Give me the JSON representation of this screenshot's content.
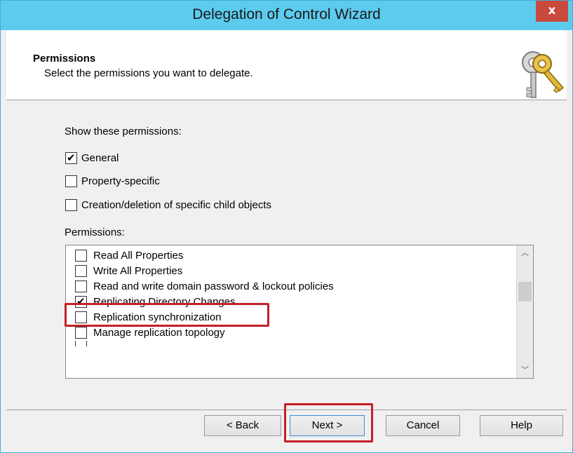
{
  "window": {
    "title": "Delegation of Control Wizard",
    "close_label": "x"
  },
  "header": {
    "title": "Permissions",
    "subtitle": "Select the permissions you want to delegate.",
    "icon": "keys-icon"
  },
  "show_permissions": {
    "label": "Show these permissions:",
    "options": [
      {
        "label": "General",
        "checked": true
      },
      {
        "label": "Property-specific",
        "checked": false
      },
      {
        "label": "Creation/deletion of specific child objects",
        "checked": false
      }
    ]
  },
  "permissions": {
    "label": "Permissions:",
    "items": [
      {
        "label": "Read All Properties",
        "checked": false
      },
      {
        "label": "Write All Properties",
        "checked": false
      },
      {
        "label": "Read and write domain password & lockout policies",
        "checked": false
      },
      {
        "label": "Replicating Directory Changes",
        "checked": true
      },
      {
        "label": "Replication synchronization",
        "checked": false
      },
      {
        "label": "Manage replication topology",
        "checked": false
      }
    ]
  },
  "buttons": {
    "back": "< Back",
    "next": "Next >",
    "cancel": "Cancel",
    "help": "Help"
  },
  "colors": {
    "titlebar": "#5ccbee",
    "close": "#c94a3c",
    "highlight": "#c42027"
  }
}
